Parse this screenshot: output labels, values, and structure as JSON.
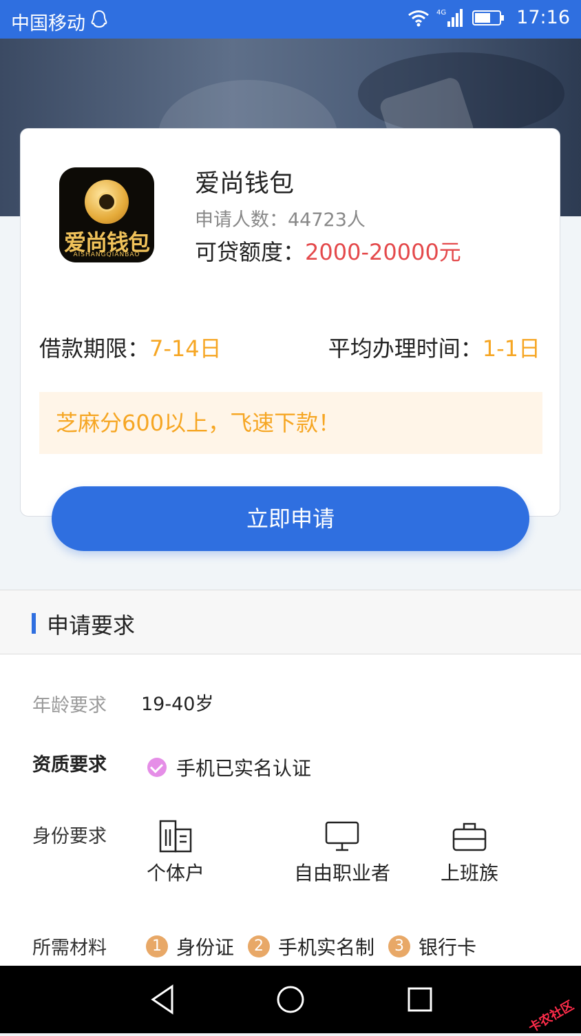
{
  "status_bar": {
    "carrier": "中国移动",
    "time": "17:16",
    "network": "4G"
  },
  "product": {
    "logo_text": "爱尚钱包",
    "logo_subtext": "AISHANGQIANBAO",
    "name": "爱尚钱包",
    "applicants_label": "申请人数：",
    "applicants_value": "44723人",
    "quota_label": "可贷额度：",
    "quota_value": "2000-20000元",
    "term_label": "借款期限：",
    "term_value": "7-14日",
    "avg_time_label": "平均办理时间：",
    "avg_time_value": "1-1日",
    "notice": "芝麻分600以上，飞速下款！",
    "apply_button": "立即申请"
  },
  "requirements": {
    "section_title": "申请要求",
    "age_label": "年龄要求",
    "age_value": "19-40岁",
    "qualification_label": "资质要求",
    "qualification_value": "手机已实名认证",
    "identity_label": "身份要求",
    "identities": [
      {
        "label": "个体户",
        "icon": "building-icon"
      },
      {
        "label": "自由职业者",
        "icon": "monitor-icon"
      },
      {
        "label": "上班族",
        "icon": "briefcase-icon"
      }
    ],
    "materials_label": "所需材料",
    "materials": [
      {
        "num": "1",
        "label": "身份证"
      },
      {
        "num": "2",
        "label": "手机实名制"
      },
      {
        "num": "3",
        "label": "银行卡"
      }
    ]
  },
  "watermark": "卡农社区",
  "colors": {
    "primary": "#2f6fe0",
    "quota_red": "#e4494b",
    "accent_orange": "#f6a623",
    "material_badge": "#e8a867",
    "check_pink": "#e58ee7"
  }
}
